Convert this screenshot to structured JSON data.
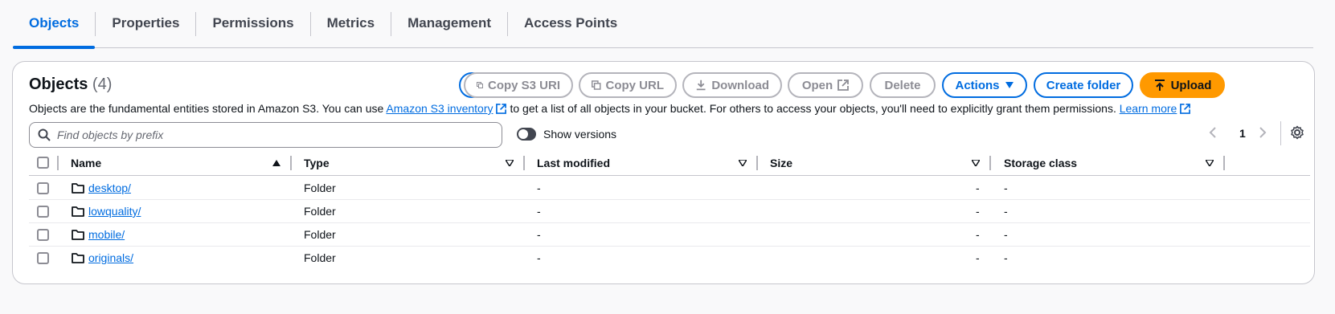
{
  "tabs": [
    {
      "label": "Objects",
      "active": true
    },
    {
      "label": "Properties",
      "active": false
    },
    {
      "label": "Permissions",
      "active": false
    },
    {
      "label": "Metrics",
      "active": false
    },
    {
      "label": "Management",
      "active": false
    },
    {
      "label": "Access Points",
      "active": false
    }
  ],
  "panel": {
    "title": "Objects",
    "count": "(4)",
    "description_before": "Objects are the fundamental entities stored in Amazon S3. You can use",
    "inventory_link": "Amazon S3 inventory",
    "description_after": "to get a list of all objects in your bucket. For others to access your objects, you'll need to explicitly grant them permissions.",
    "learn_more": "Learn more"
  },
  "toolbar": {
    "copy_s3_uri": "Copy S3 URI",
    "copy_url": "Copy URL",
    "download": "Download",
    "open": "Open",
    "delete": "Delete",
    "actions": "Actions",
    "create_folder": "Create folder",
    "upload": "Upload"
  },
  "search": {
    "placeholder": "Find objects by prefix",
    "value": ""
  },
  "versions": {
    "label": "Show versions",
    "enabled": false
  },
  "pagination": {
    "page": "1"
  },
  "table": {
    "columns": [
      "Name",
      "Type",
      "Last modified",
      "Size",
      "Storage class"
    ],
    "rows": [
      {
        "name": "desktop/",
        "type": "Folder",
        "last_modified": "-",
        "size": "-",
        "storage_class": "-"
      },
      {
        "name": "lowquality/",
        "type": "Folder",
        "last_modified": "-",
        "size": "-",
        "storage_class": "-"
      },
      {
        "name": "mobile/",
        "type": "Folder",
        "last_modified": "-",
        "size": "-",
        "storage_class": "-"
      },
      {
        "name": "originals/",
        "type": "Folder",
        "last_modified": "-",
        "size": "-",
        "storage_class": "-"
      }
    ]
  },
  "colors": {
    "accent": "#006ce0",
    "upload": "#ff9900",
    "text": "#0f141a",
    "disabled": "#8c8c94"
  }
}
